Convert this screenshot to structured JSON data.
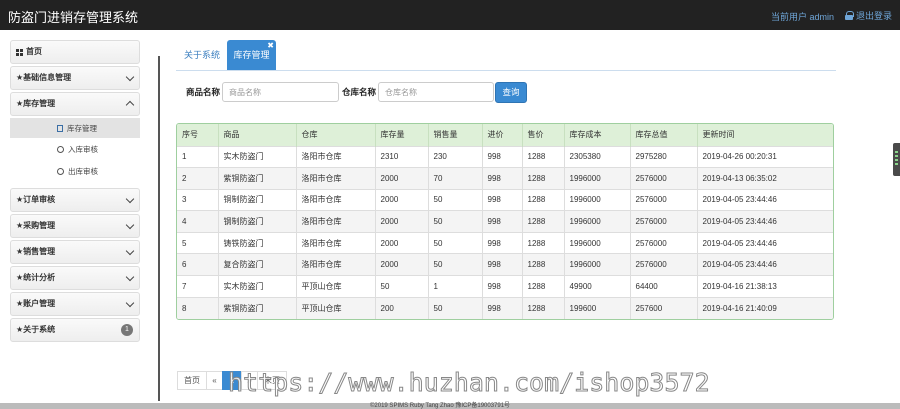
{
  "header": {
    "title": "防盗门进销存管理系统",
    "user_text": "当前用户 admin",
    "logout_label": "退出登录"
  },
  "sidebar": {
    "items": [
      {
        "label": "首页"
      },
      {
        "label": "★基础信息管理"
      },
      {
        "label": "★库存管理",
        "expanded": true,
        "children": [
          {
            "label": "库存管理"
          },
          {
            "label": "入库审核"
          },
          {
            "label": "出库审核"
          }
        ]
      },
      {
        "label": "★订单审核"
      },
      {
        "label": "★采购管理"
      },
      {
        "label": "★销售管理"
      },
      {
        "label": "★统计分析"
      },
      {
        "label": "★账户管理"
      },
      {
        "label": "★关于系统",
        "badge": "1"
      }
    ]
  },
  "tabs": [
    {
      "label": "关于系统"
    },
    {
      "label": "库存管理",
      "active": true,
      "close": "✖"
    }
  ],
  "search": {
    "goods_label": "商品名称",
    "goods_placeholder": "商品名称",
    "warehouse_label": "仓库名称",
    "warehouse_placeholder": "仓库名称",
    "button": "查询"
  },
  "table": {
    "headers": [
      "序号",
      "商品",
      "仓库",
      "库存量",
      "销售量",
      "进价",
      "售价",
      "库存成本",
      "库存总值",
      "更新时间"
    ],
    "rows": [
      [
        "1",
        "实木防盗门",
        "洛阳市仓库",
        "2310",
        "230",
        "998",
        "1288",
        "2305380",
        "2975280",
        "2019-04-26 00:20:31"
      ],
      [
        "2",
        "紫铜防盗门",
        "洛阳市仓库",
        "2000",
        "70",
        "998",
        "1288",
        "1996000",
        "2576000",
        "2019-04-13 06:35:02"
      ],
      [
        "3",
        "铜制防盗门",
        "洛阳市仓库",
        "2000",
        "50",
        "998",
        "1288",
        "1996000",
        "2576000",
        "2019-04-05 23:44:46"
      ],
      [
        "4",
        "钢制防盗门",
        "洛阳市仓库",
        "2000",
        "50",
        "998",
        "1288",
        "1996000",
        "2576000",
        "2019-04-05 23:44:46"
      ],
      [
        "5",
        "铸铁防盗门",
        "洛阳市仓库",
        "2000",
        "50",
        "998",
        "1288",
        "1996000",
        "2576000",
        "2019-04-05 23:44:46"
      ],
      [
        "6",
        "复合防盗门",
        "洛阳市仓库",
        "2000",
        "50",
        "998",
        "1288",
        "1996000",
        "2576000",
        "2019-04-05 23:44:46"
      ],
      [
        "7",
        "实木防盗门",
        "平顶山仓库",
        "50",
        "1",
        "998",
        "1288",
        "49900",
        "64400",
        "2019-04-16 21:38:13"
      ],
      [
        "8",
        "紫铜防盗门",
        "平顶山仓库",
        "200",
        "50",
        "998",
        "1288",
        "199600",
        "257600",
        "2019-04-16 21:40:09"
      ]
    ]
  },
  "pager": {
    "first": "首页",
    "prev": "«",
    "page": "1",
    "next": "»",
    "last": "末页"
  },
  "footer": {
    "text": "©2019 SPIMS Ruby Tang Zhao 豫ICP备19003791号"
  },
  "watermark": "https://www.huzhan.com/ishop3572"
}
